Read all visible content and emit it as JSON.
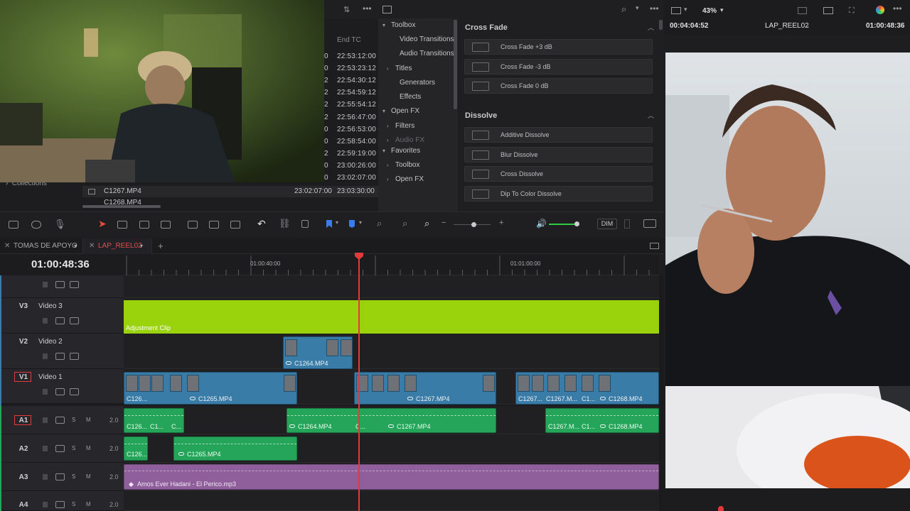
{
  "media_pool": {
    "end_tc_header": "End TC",
    "rows": [
      {
        "start_tail": "0",
        "end_tc": "22:53:12:00"
      },
      {
        "start_tail": "0",
        "end_tc": "22:53:23:12"
      },
      {
        "start_tail": "2",
        "end_tc": "22:54:30:12"
      },
      {
        "start_tail": "2",
        "end_tc": "22:54:59:12"
      },
      {
        "start_tail": "2",
        "end_tc": "22:55:54:12"
      },
      {
        "start_tail": "2",
        "end_tc": "22:56:47:00"
      },
      {
        "start_tail": "0",
        "end_tc": "22:56:53:00"
      },
      {
        "start_tail": "0",
        "end_tc": "22:58:54:00"
      },
      {
        "start_tail": "2",
        "end_tc": "22:59:19:00"
      },
      {
        "start_tail": "0",
        "end_tc": "23:00:26:00"
      },
      {
        "start_tail": "0",
        "end_tc": "23:02:07:00"
      }
    ],
    "collections_label": "Collections",
    "clip_rows": [
      {
        "name": "C1267.MP4",
        "start_tc": "23:02:07:00",
        "end_tc": "23:03:30:00"
      },
      {
        "name": "C1268.MP4",
        "start_tc": "",
        "end_tc": ""
      }
    ]
  },
  "fx_tree": {
    "items": [
      {
        "label": "Toolbox",
        "arrow": "▾",
        "indent": 0
      },
      {
        "label": "Video Transitions",
        "arrow": "",
        "indent": 2
      },
      {
        "label": "Audio Transitions",
        "arrow": "",
        "indent": 2
      },
      {
        "label": "Titles",
        "arrow": "›",
        "indent": 1
      },
      {
        "label": "Generators",
        "arrow": "",
        "indent": 2
      },
      {
        "label": "Effects",
        "arrow": "",
        "indent": 2
      },
      {
        "label": "Open FX",
        "arrow": "▾",
        "indent": 0
      },
      {
        "label": "Filters",
        "arrow": "›",
        "indent": 1
      },
      {
        "label": "Audio FX",
        "arrow": "›",
        "indent": 1
      },
      {
        "label": "Favorites",
        "arrow": "▾",
        "indent": 0
      },
      {
        "label": "Toolbox",
        "arrow": "›",
        "indent": 1
      },
      {
        "label": "Open FX",
        "arrow": "›",
        "indent": 1
      }
    ]
  },
  "fx_panel": {
    "cross_fade_title": "Cross Fade",
    "cross_fade_items": [
      "Cross Fade +3 dB",
      "Cross Fade -3 dB",
      "Cross Fade 0 dB"
    ],
    "dissolve_title": "Dissolve",
    "dissolve_items": [
      "Additive Dissolve",
      "Blur Dissolve",
      "Cross Dissolve",
      "Dip To Color Dissolve"
    ]
  },
  "viewer": {
    "zoom": "43%",
    "source_tc": "00:04:04:52",
    "timeline_name": "LAP_REEL02",
    "record_tc": "01:00:48:36"
  },
  "toolbar": {
    "dim_label": "DIM",
    "zoom_minus": "−",
    "zoom_plus": "+"
  },
  "tabs": {
    "tab1": "TOMAS DE APOYO",
    "tab2": "LAP_REEL02",
    "add": "+"
  },
  "timeline": {
    "timecode": "01:00:48:36",
    "ruler_marks": [
      "01:00:40:00",
      "01:01:00:00"
    ],
    "tracks": {
      "v3": {
        "id": "V3",
        "name": "Video 3"
      },
      "v2": {
        "id": "V2",
        "name": "Video 2"
      },
      "v1": {
        "id": "V1",
        "name": "Video 1"
      },
      "a1": {
        "id": "A1",
        "vol": "2.0"
      },
      "a2": {
        "id": "A2",
        "vol": "2.0"
      },
      "a3": {
        "id": "A3",
        "vol": "2.0"
      },
      "a4": {
        "id": "A4",
        "vol": "2.0"
      }
    },
    "solo_label": "S",
    "mute_label": "M",
    "adjustment_clip": "Adjustment Clip",
    "v2_clip": "C1264.MP4",
    "v1_clips": [
      "C126...",
      "C1265.MP4",
      "C1267.MP4",
      "C1267...",
      "C1267.M...",
      "C1...",
      "C1268.MP4"
    ],
    "a1_clips": [
      "C126...",
      "C1...",
      "C...",
      "C1264.MP4",
      "C...",
      "C1267.MP4",
      "C1267.M...",
      "C1...",
      "C1268.MP4"
    ],
    "a2_clips": [
      "C126...",
      "C1265.MP4"
    ],
    "music_clip": "Amos Ever Hadani - El Perico.mp3"
  },
  "colors": {
    "video_clip": "#3a7ca8",
    "audio_clip": "#25a55a",
    "music_clip": "#8f5f9c",
    "adjustment_clip": "#9ad30c",
    "playhead": "#e23a3a",
    "tab_active": "#e64b4b"
  }
}
